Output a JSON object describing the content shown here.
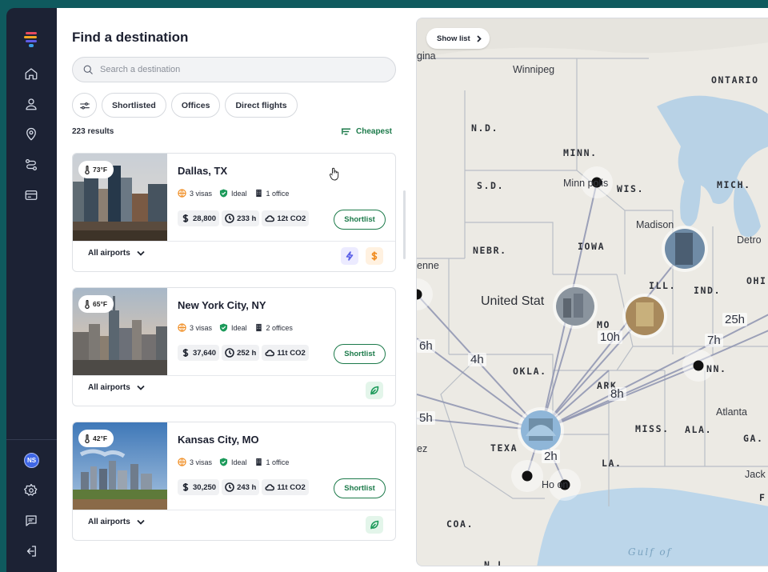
{
  "sidebar": {
    "logo_colors": [
      "#e84a5f",
      "#f6a623",
      "#3aa0e8",
      "#5e5ce6"
    ],
    "nav_icons": [
      "home-icon",
      "user-icon",
      "location-pin-icon",
      "route-icon",
      "credit-card-icon"
    ],
    "avatar_initials": "NS",
    "bottom_icons": [
      "settings-icon",
      "chat-icon",
      "logout-icon"
    ]
  },
  "main": {
    "title": "Find a destination",
    "search_placeholder": "Search a destination",
    "filters": [
      "Shortlisted",
      "Offices",
      "Direct flights"
    ],
    "results_count": "223 results",
    "sort_label": "Cheapest"
  },
  "cards": [
    {
      "city": "Dallas, TX",
      "temperature": "73°F",
      "visas": "3 visas",
      "rating": "Ideal",
      "offices": "1 office",
      "cost": "28,800",
      "time": "233 h",
      "co2": "12t CO2",
      "shortlist_label": "Shortlist",
      "airports_label": "All airports",
      "tags": [
        "lightning-icon",
        "dollar-icon"
      ]
    },
    {
      "city": "New York City, NY",
      "temperature": "65°F",
      "visas": "3 visas",
      "rating": "Ideal",
      "offices": "2 offices",
      "cost": "37,640",
      "time": "252 h",
      "co2": "11t CO2",
      "shortlist_label": "Shortlist",
      "airports_label": "All airports",
      "tags": [
        "leaf-icon"
      ]
    },
    {
      "city": "Kansas City, MO",
      "temperature": "42°F",
      "visas": "3 visas",
      "rating": "Ideal",
      "offices": "1 office",
      "cost": "30,250",
      "time": "243 h",
      "co2": "11t CO2",
      "shortlist_label": "Shortlist",
      "airports_label": "All airports",
      "tags": [
        "leaf-icon"
      ]
    }
  ],
  "map": {
    "show_list_label": "Show list",
    "labels": {
      "regina": "gina",
      "winnipeg": "Winnipeg",
      "ontario": "ONTARIO",
      "nd": "N.D.",
      "minn": "MINN.",
      "sd": "S.D.",
      "minneapolis": "Minn  polis",
      "wis": "WIS.",
      "mich": "MICH.",
      "madison": "Madison",
      "detroit": "Detro",
      "nebr": "NEBR.",
      "iowa": "IOWA",
      "ill": "ILL.",
      "ind": "IND.",
      "ohio": "OHI",
      "cheyenne": "enne",
      "us": "United Stat",
      "mo": "MO",
      "okla": "OKLA.",
      "ark": "ARK",
      "tenn": "NN.",
      "atlanta": "Atlanta",
      "miss": "MISS.",
      "ala": "ALA.",
      "ga": "GA.",
      "texas": "TEXA",
      "la": "LA.",
      "houston": "Ho   on",
      "jackson": "Jack",
      "fla": "F",
      "paz": "ez",
      "coa": "COA.",
      "nl": "N.L.",
      "gulf": "Gulf of"
    },
    "hours": [
      "6h",
      "4h",
      "10h",
      "8h",
      "2h",
      "5h",
      "7h",
      "25h"
    ]
  }
}
